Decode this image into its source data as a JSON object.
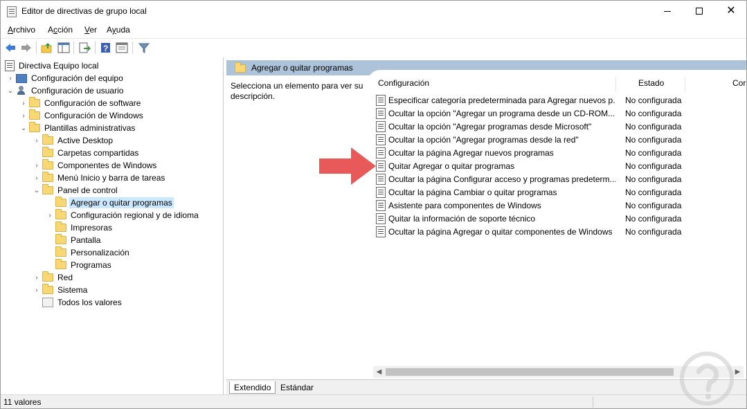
{
  "window": {
    "title": "Editor de directivas de grupo local",
    "controls": {
      "minimize": "minimize-icon",
      "maximize": "maximize-icon",
      "close": "close-icon"
    }
  },
  "menu": {
    "items": [
      {
        "label": "Archivo",
        "accesskey": "A"
      },
      {
        "label": "Acción",
        "accesskey": "c"
      },
      {
        "label": "Ver",
        "accesskey": "V"
      },
      {
        "label": "Ayuda",
        "accesskey": "y"
      }
    ]
  },
  "toolbar": {
    "buttons": [
      "back-arrow-icon",
      "forward-arrow-icon",
      "up-folder-icon",
      "show-hide-tree-icon",
      "export-list-icon",
      "help-icon",
      "properties-view-icon",
      "filter-icon"
    ]
  },
  "tree": {
    "root": "Directiva Equipo local",
    "items": [
      {
        "label": "Configuración del equipo",
        "icon": "computer-icon"
      },
      {
        "label": "Configuración de usuario",
        "icon": "user-icon"
      },
      {
        "label": "Configuración de software",
        "icon": "folder-icon"
      },
      {
        "label": "Configuración de Windows",
        "icon": "folder-icon"
      },
      {
        "label": "Plantillas administrativas",
        "icon": "folder-icon"
      },
      {
        "label": "Active Desktop",
        "icon": "folder-icon"
      },
      {
        "label": "Carpetas compartidas",
        "icon": "folder-icon"
      },
      {
        "label": "Componentes de Windows",
        "icon": "folder-icon"
      },
      {
        "label": "Menú Inicio y barra de tareas",
        "icon": "folder-icon"
      },
      {
        "label": "Panel de control",
        "icon": "folder-icon"
      },
      {
        "label": "Agregar o quitar programas",
        "icon": "folder-icon"
      },
      {
        "label": "Configuración regional y de idioma",
        "icon": "folder-icon"
      },
      {
        "label": "Impresoras",
        "icon": "folder-icon"
      },
      {
        "label": "Pantalla",
        "icon": "folder-icon"
      },
      {
        "label": "Personalización",
        "icon": "folder-icon"
      },
      {
        "label": "Programas",
        "icon": "folder-icon"
      },
      {
        "label": "Red",
        "icon": "folder-icon"
      },
      {
        "label": "Sistema",
        "icon": "folder-icon"
      },
      {
        "label": "Todos los valores",
        "icon": "all-values-icon"
      }
    ]
  },
  "right": {
    "header_title": "Agregar o quitar programas",
    "description": "Selecciona un elemento para ver su descripción.",
    "columns": [
      "Configuración",
      "Estado",
      "Cor"
    ],
    "rows": [
      {
        "name": "Especificar categoría predeterminada para Agregar nuevos p...",
        "state": "No configurada"
      },
      {
        "name": "Ocultar la opción \"Agregar un programa desde un CD-ROM...",
        "state": "No configurada"
      },
      {
        "name": "Ocultar la opción \"Agregar programas desde Microsoft\"",
        "state": "No configurada"
      },
      {
        "name": "Ocultar la opción \"Agregar programas desde la red\"",
        "state": "No configurada"
      },
      {
        "name": "Ocultar la página Agregar nuevos programas",
        "state": "No configurada"
      },
      {
        "name": "Quitar Agregar o quitar programas",
        "state": "No configurada"
      },
      {
        "name": "Ocultar la página Configurar acceso y programas predeterm...",
        "state": "No configurada"
      },
      {
        "name": "Ocultar la página Cambiar o quitar programas",
        "state": "No configurada"
      },
      {
        "name": "Asistente para componentes de Windows",
        "state": "No configurada"
      },
      {
        "name": "Quitar la información de soporte técnico",
        "state": "No configurada"
      },
      {
        "name": "Ocultar la página Agregar o quitar componentes de Windows",
        "state": "No configurada"
      }
    ],
    "tabs": [
      "Extendido",
      "Estándar"
    ]
  },
  "status": {
    "text": "11 valores"
  },
  "colors": {
    "header_bg": "#acc3d9",
    "selection": "#cce8ff",
    "arrow": "#e8595a"
  }
}
